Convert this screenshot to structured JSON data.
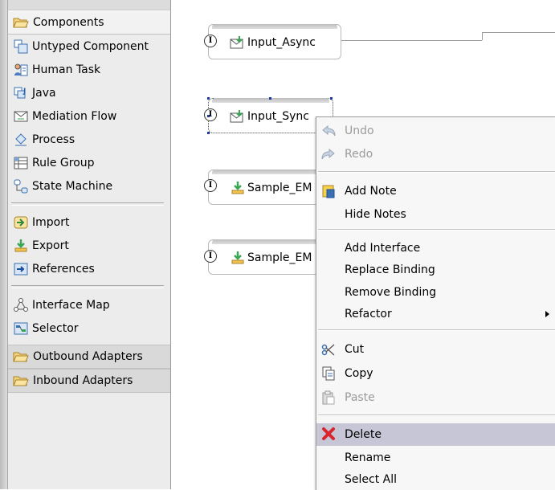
{
  "palette": {
    "drawers": {
      "components": "Components",
      "outbound": "Outbound Adapters",
      "inbound": "Inbound Adapters"
    },
    "items": {
      "untyped": "Untyped Component",
      "human_task": "Human Task",
      "java": "Java",
      "mediation_flow": "Mediation Flow",
      "process": "Process",
      "rule_group": "Rule Group",
      "state_machine": "State Machine",
      "import": "Import",
      "export": "Export",
      "references": "References",
      "interface_map": "Interface Map",
      "selector": "Selector"
    }
  },
  "canvas": {
    "nodes": [
      {
        "label": "Input_Async"
      },
      {
        "label": "Input_Sync"
      },
      {
        "label": "Sample_EM"
      },
      {
        "label": "Sample_EM"
      }
    ],
    "interface_glyph": "I"
  },
  "menu": {
    "undo": "Undo",
    "redo": "Redo",
    "add_note": "Add Note",
    "hide_notes": "Hide Notes",
    "add_interface": "Add Interface",
    "replace_binding": "Replace Binding",
    "remove_binding": "Remove Binding",
    "refactor": "Refactor",
    "cut": "Cut",
    "copy": "Copy",
    "paste": "Paste",
    "delete": "Delete",
    "rename": "Rename",
    "select_all": "Select All"
  },
  "colors": {
    "highlight": "#c6c6d6",
    "folder": "#f2c14e",
    "export_arrow": "#3aa655",
    "delete_x": "#d9262b"
  }
}
